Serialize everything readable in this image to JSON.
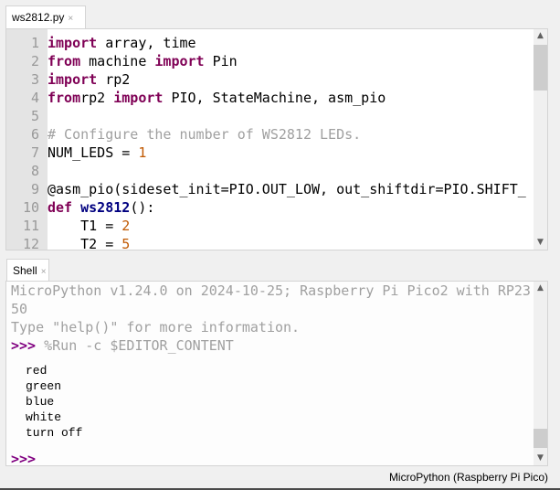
{
  "editor": {
    "tab": {
      "label": "ws2812.py",
      "close_icon": "×"
    },
    "lines": [
      {
        "n": "1",
        "tokens": [
          [
            "kw",
            "import"
          ],
          [
            "",
            "array, time"
          ]
        ]
      },
      {
        "n": "2",
        "tokens": [
          [
            "kw",
            "from"
          ],
          [
            "",
            "machine "
          ],
          [
            "kw",
            "import"
          ],
          [
            "",
            " Pin"
          ]
        ]
      },
      {
        "n": "3",
        "tokens": [
          [
            "kw",
            "import"
          ],
          [
            "",
            " rp2"
          ]
        ]
      },
      {
        "n": "4",
        "tokens": [
          [
            "kw",
            "from"
          ],
          [
            "",
            "",
            " "
          ],
          [
            "",
            "rp2 "
          ],
          [
            "kw",
            "import"
          ],
          [
            "",
            " PIO, StateMachine, asm_pio"
          ]
        ]
      },
      {
        "n": "5",
        "tokens": []
      },
      {
        "n": "6",
        "tokens": [
          [
            "cm",
            "# Configure the number of WS2812 LEDs."
          ]
        ]
      },
      {
        "n": "7",
        "tokens": [
          [
            "",
            "NUM_LEDS = "
          ],
          [
            "num",
            "1"
          ]
        ]
      },
      {
        "n": "8",
        "tokens": []
      },
      {
        "n": "9",
        "tokens": [
          [
            "",
            "@asm_pio(sideset_init=PIO.OUT_LOW, out_shiftdir=PIO.SHIFT_"
          ]
        ]
      },
      {
        "n": "10",
        "tokens": [
          [
            "kw",
            "def"
          ],
          [
            "",
            " "
          ],
          [
            "fn",
            "ws2812"
          ],
          [
            "",
            "():"
          ]
        ]
      },
      {
        "n": "11",
        "tokens": [
          [
            "",
            "    T1 = "
          ],
          [
            "num",
            "2"
          ]
        ]
      },
      {
        "n": "12",
        "tokens": [
          [
            "",
            "    T2 = "
          ],
          [
            "num",
            "5"
          ]
        ]
      }
    ]
  },
  "shell": {
    "tab": {
      "label": "Shell",
      "close_icon": "×"
    },
    "banner_line1": "MicroPython v1.24.0 on 2024-10-25; Raspberry Pi Pico2 with RP23",
    "banner_line2": "50",
    "help_line": "Type \"help()\" for more information.",
    "prompt": ">>>",
    "command": " %Run -c $EDITOR_CONTENT",
    "output": [
      "red",
      "green",
      "blue",
      "white",
      "turn off"
    ],
    "final_prompt": ">>>"
  },
  "scroll": {
    "up_icon": "^",
    "down_icon": "v"
  },
  "status_bar": {
    "interpreter": "MicroPython (Raspberry Pi Pico)"
  }
}
